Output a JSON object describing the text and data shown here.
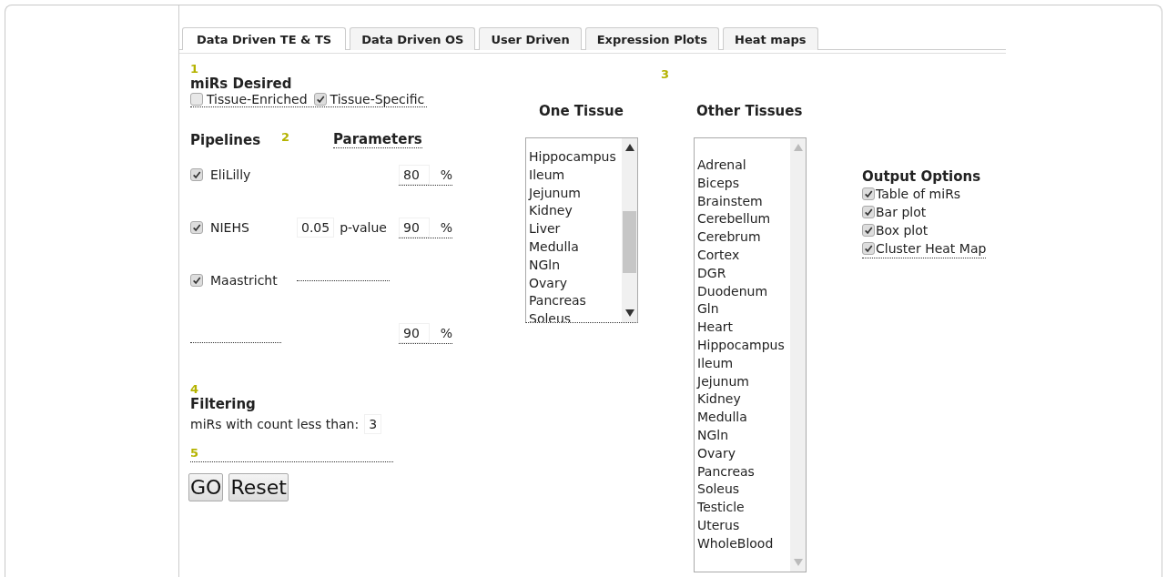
{
  "tabs": [
    {
      "label": "Data Driven TE & TS",
      "selected": true
    },
    {
      "label": "Data Driven OS",
      "selected": false
    },
    {
      "label": "User Driven",
      "selected": false
    },
    {
      "label": "Expression Plots",
      "selected": false
    },
    {
      "label": "Heat maps",
      "selected": false
    }
  ],
  "mirs_desired": {
    "number": "1",
    "title": "miRs Desired",
    "options": [
      {
        "label": "Tissue-Enriched",
        "checked": false
      },
      {
        "label": "Tissue-Specific",
        "checked": true
      }
    ]
  },
  "pipelines": {
    "number": "2",
    "title": "Pipelines",
    "parameters_title": "Parameters",
    "rows": [
      {
        "label": "EliLilly",
        "checked": true,
        "kind": "inline",
        "percent": "80",
        "unit": "%"
      },
      {
        "label": "NIEHS",
        "checked": true,
        "kind": "inline",
        "pvalue": "0.05",
        "pvalue_label": "p-value",
        "percent": "90",
        "unit": "%"
      },
      {
        "label": "Maastricht",
        "checked": true,
        "kind": "below",
        "percent": "90",
        "unit": "%"
      }
    ]
  },
  "tissues": {
    "number": "3",
    "one_tissue": {
      "title": "One Tissue",
      "items": [
        "Hippocampus",
        "Ileum",
        "Jejunum",
        "Kidney",
        "Liver",
        "Medulla",
        "NGln",
        "Ovary",
        "Pancreas",
        "Soleus"
      ]
    },
    "other_tissues": {
      "title": "Other Tissues",
      "items": [
        "Adrenal",
        "Biceps",
        "Brainstem",
        "Cerebellum",
        "Cerebrum",
        "Cortex",
        "DGR",
        "Duodenum",
        "Gln",
        "Heart",
        "Hippocampus",
        "Ileum",
        "Jejunum",
        "Kidney",
        "Medulla",
        "NGln",
        "Ovary",
        "Pancreas",
        "Soleus",
        "Testicle",
        "Uterus",
        "WholeBlood"
      ]
    }
  },
  "filtering": {
    "number": "4",
    "title": "Filtering",
    "label": "miRs with count less than:",
    "value": "3"
  },
  "run": {
    "number": "5",
    "buttons": [
      "GO",
      "Reset"
    ]
  },
  "output_options": {
    "title": "Output Options",
    "options": [
      {
        "label": "Table of miRs",
        "checked": true
      },
      {
        "label": "Bar plot",
        "checked": true
      },
      {
        "label": "Box plot",
        "checked": true
      },
      {
        "label": "Cluster Heat Map",
        "checked": true
      }
    ]
  }
}
